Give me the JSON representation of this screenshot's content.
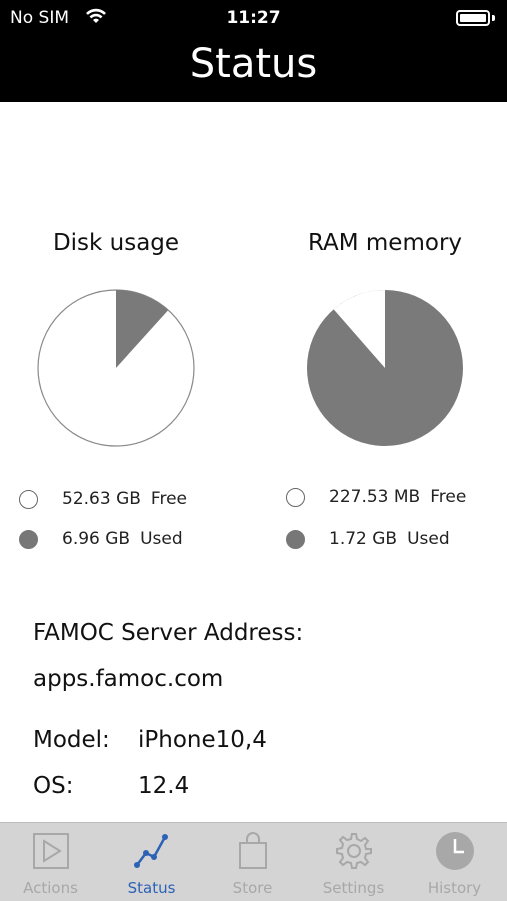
{
  "status_bar": {
    "carrier": "No SIM",
    "time": "11:27"
  },
  "nav": {
    "title": "Status"
  },
  "disk": {
    "title": "Disk usage",
    "free_value": "52.63 GB",
    "free_label": "Free",
    "used_value": "6.96 GB",
    "used_label": "Used"
  },
  "ram": {
    "title": "RAM memory",
    "free_value": "227.53 MB",
    "free_label": "Free",
    "used_value": "1.72 GB",
    "used_label": "Used"
  },
  "info": {
    "server_label": "FAMOC Server Address:",
    "server_value": "apps.famoc.com",
    "model_label": "Model:",
    "model_value": "iPhone10,4",
    "os_label": "OS:",
    "os_value": "12.4"
  },
  "chart_data": [
    {
      "type": "pie",
      "title": "Disk usage",
      "categories": [
        "Free",
        "Used"
      ],
      "values": [
        52.63,
        6.96
      ],
      "unit": "GB",
      "colors": [
        "#ffffff",
        "#7a7a7a"
      ]
    },
    {
      "type": "pie",
      "title": "RAM memory",
      "categories": [
        "Free",
        "Used"
      ],
      "values": [
        0.2222,
        1.72
      ],
      "unit": "GB",
      "colors": [
        "#ffffff",
        "#7a7a7a"
      ]
    }
  ],
  "tabs": [
    {
      "label": "Actions",
      "icon": "play-icon",
      "active": false
    },
    {
      "label": "Status",
      "icon": "graph-icon",
      "active": true
    },
    {
      "label": "Store",
      "icon": "shopping-bag-icon",
      "active": false
    },
    {
      "label": "Settings",
      "icon": "gear-icon",
      "active": false
    },
    {
      "label": "History",
      "icon": "clock-icon",
      "active": false
    }
  ],
  "colors": {
    "accent": "#2b62b5",
    "used": "#7a7a7a",
    "tab_inactive": "#a8a8a8",
    "tabbar_bg": "#d4d4d4"
  }
}
